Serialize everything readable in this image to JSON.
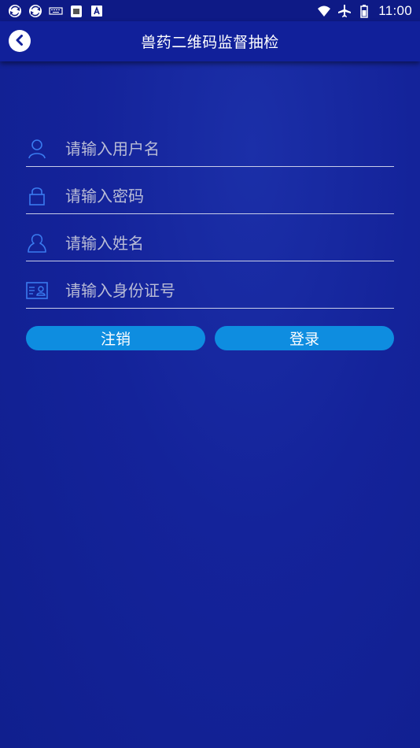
{
  "status_bar": {
    "time": "11:00",
    "left_icons": [
      "sync-icon",
      "sync-icon",
      "keyboard-icon",
      "notification-icon",
      "font-icon"
    ],
    "right_icons": [
      "wifi-icon",
      "airplane-mode-icon",
      "battery-icon"
    ]
  },
  "header": {
    "title": "兽药二维码监督抽检",
    "back_icon": "back-arrow-icon"
  },
  "form": {
    "username": {
      "placeholder": "请输入用户名",
      "value": "",
      "icon": "user-icon"
    },
    "password": {
      "placeholder": "请输入密码",
      "value": "",
      "icon": "lock-icon"
    },
    "name": {
      "placeholder": "请输入姓名",
      "value": "",
      "icon": "person-icon"
    },
    "id_number": {
      "placeholder": "请输入身份证号",
      "value": "",
      "icon": "id-card-icon"
    }
  },
  "buttons": {
    "cancel_label": "注销",
    "login_label": "登录"
  },
  "colors": {
    "background": "#14239a",
    "header": "#11209a",
    "button": "#0e8de0",
    "icon": "#3a7bef",
    "placeholder": "#b9bcd6"
  }
}
